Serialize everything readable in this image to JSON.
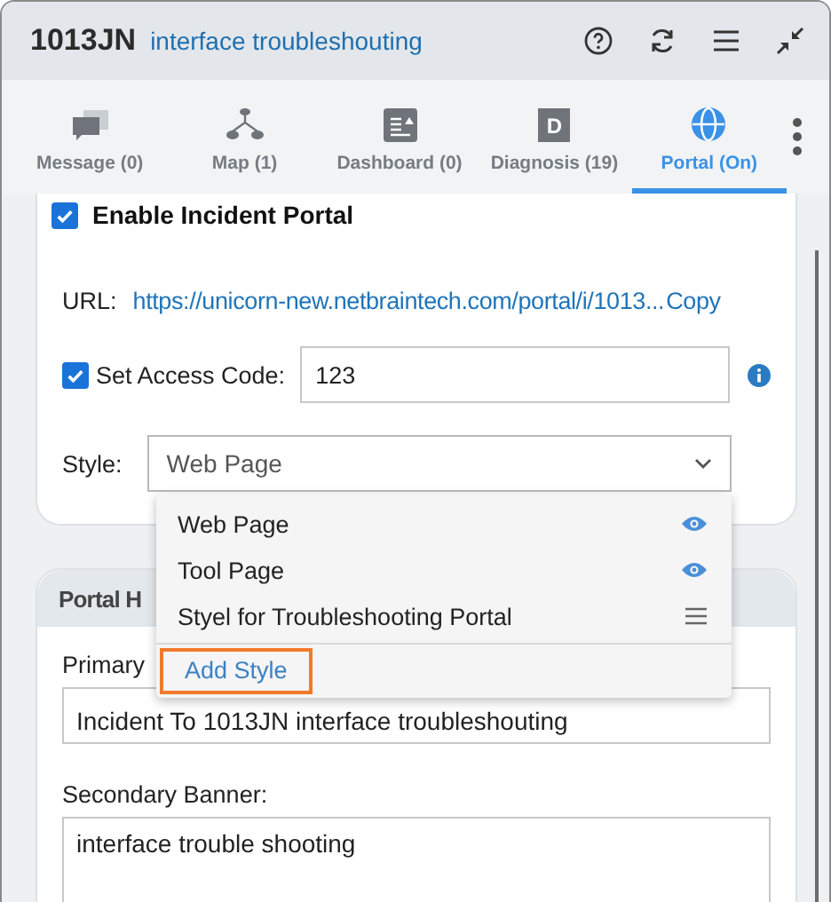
{
  "header": {
    "id": "1013JN",
    "title": "interface troubleshouting"
  },
  "tabs": [
    {
      "label": "Message (0)",
      "kind": "message",
      "selected": false
    },
    {
      "label": "Map (1)",
      "kind": "map",
      "selected": false
    },
    {
      "label": "Dashboard (0)",
      "kind": "dashboard",
      "selected": false
    },
    {
      "label": "Diagnosis (19)",
      "kind": "diagnosis",
      "letter": "D",
      "selected": false
    },
    {
      "label": "Portal (On)",
      "kind": "portal",
      "selected": true
    }
  ],
  "portal": {
    "enable": {
      "label": "Enable Incident Portal",
      "checked": true
    },
    "url_label": "URL:",
    "url": "https://unicorn-new.netbraintech.com/portal/i/1013...",
    "copy": "Copy",
    "access_code": {
      "label": "Set Access Code:",
      "checked": true,
      "value": "123"
    },
    "style": {
      "label": "Style:",
      "value": "Web Page",
      "expanded": true
    }
  },
  "style_menu": {
    "options": [
      {
        "label": "Web Page",
        "kind": "view"
      },
      {
        "label": "Tool Page",
        "kind": "view"
      },
      {
        "label": "Styel for Troubleshooting Portal",
        "kind": "list"
      }
    ],
    "add": {
      "label": "Add Style",
      "highlighted": true
    }
  },
  "banner_section": {
    "title": "Portal H",
    "fields": [
      {
        "label": "Primary",
        "value": "Incident To 1013JN interface troubleshouting"
      },
      {
        "label": "Secondary Banner:",
        "value": "interface trouble shooting"
      }
    ]
  }
}
